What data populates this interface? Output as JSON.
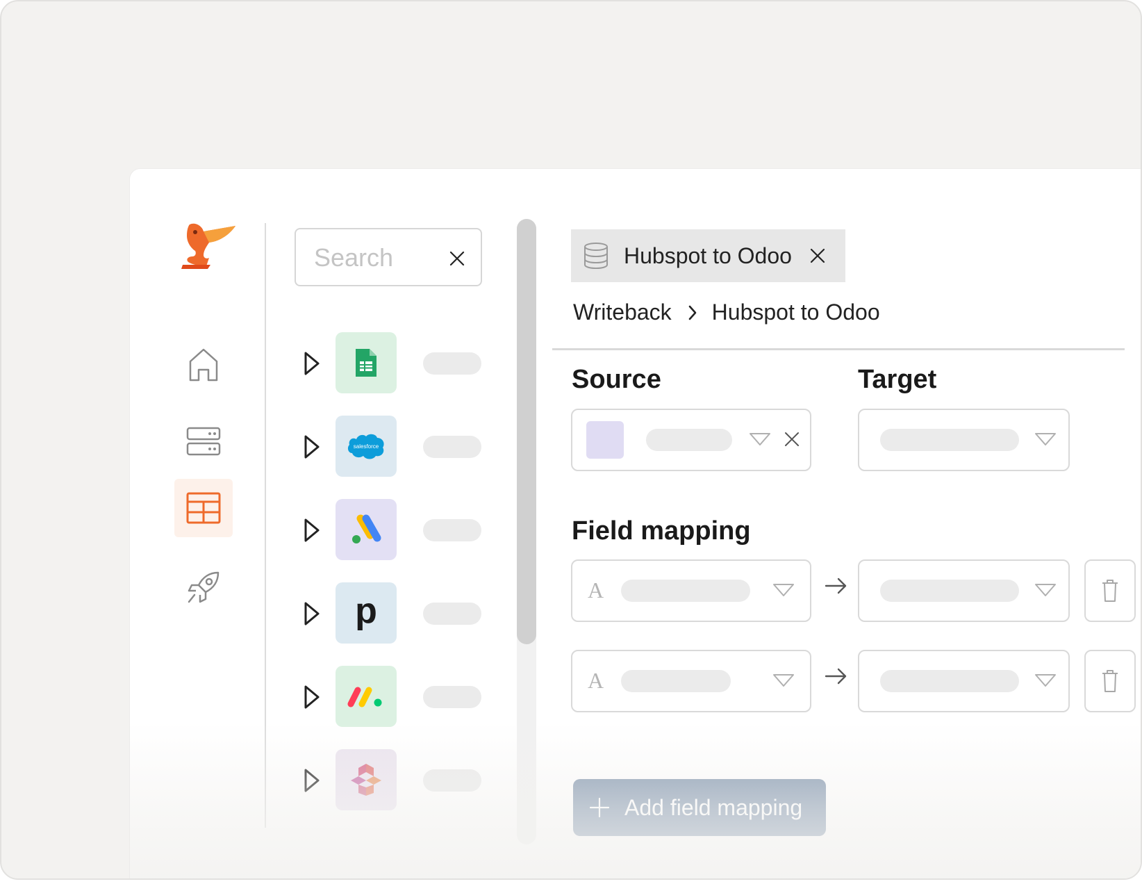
{
  "sidebar": {
    "logo": "pelican-logo",
    "items": [
      {
        "icon": "home-icon",
        "active": false
      },
      {
        "icon": "server-icon",
        "active": false
      },
      {
        "icon": "table-icon",
        "active": true
      },
      {
        "icon": "rocket-icon",
        "active": false
      }
    ],
    "active_color": "#ee6a2b",
    "active_bg": "#fdf1ea"
  },
  "search": {
    "placeholder": "Search",
    "value": ""
  },
  "sources_list": [
    {
      "app": "google-sheets-icon",
      "bg": "#dcf1e2"
    },
    {
      "app": "salesforce-icon",
      "bg": "#dde9f1",
      "label": "salesforce"
    },
    {
      "app": "google-ads-icon",
      "bg": "#e3e0f4"
    },
    {
      "app": "pipedrive-icon",
      "bg": "#dce9f1",
      "label": "p"
    },
    {
      "app": "monday-icon",
      "bg": "#dcf1e2"
    },
    {
      "app": "hexagon-app-icon",
      "bg": "#ebe4ef"
    }
  ],
  "tab": {
    "title": "Hubspot to Odoo",
    "icon": "database-icon"
  },
  "breadcrumb": {
    "parent": "Writeback",
    "current": "Hubspot to Odoo"
  },
  "source": {
    "heading": "Source",
    "swatch_color": "#e0dcf3"
  },
  "target": {
    "heading": "Target"
  },
  "field_mapping": {
    "heading": "Field mapping",
    "type_glyph": "A",
    "rows": 2
  },
  "add_button": {
    "label": "Add field mapping"
  },
  "colors": {
    "accent": "#ee6a2b",
    "button": "#8498b0",
    "skeleton": "#ebebeb"
  }
}
